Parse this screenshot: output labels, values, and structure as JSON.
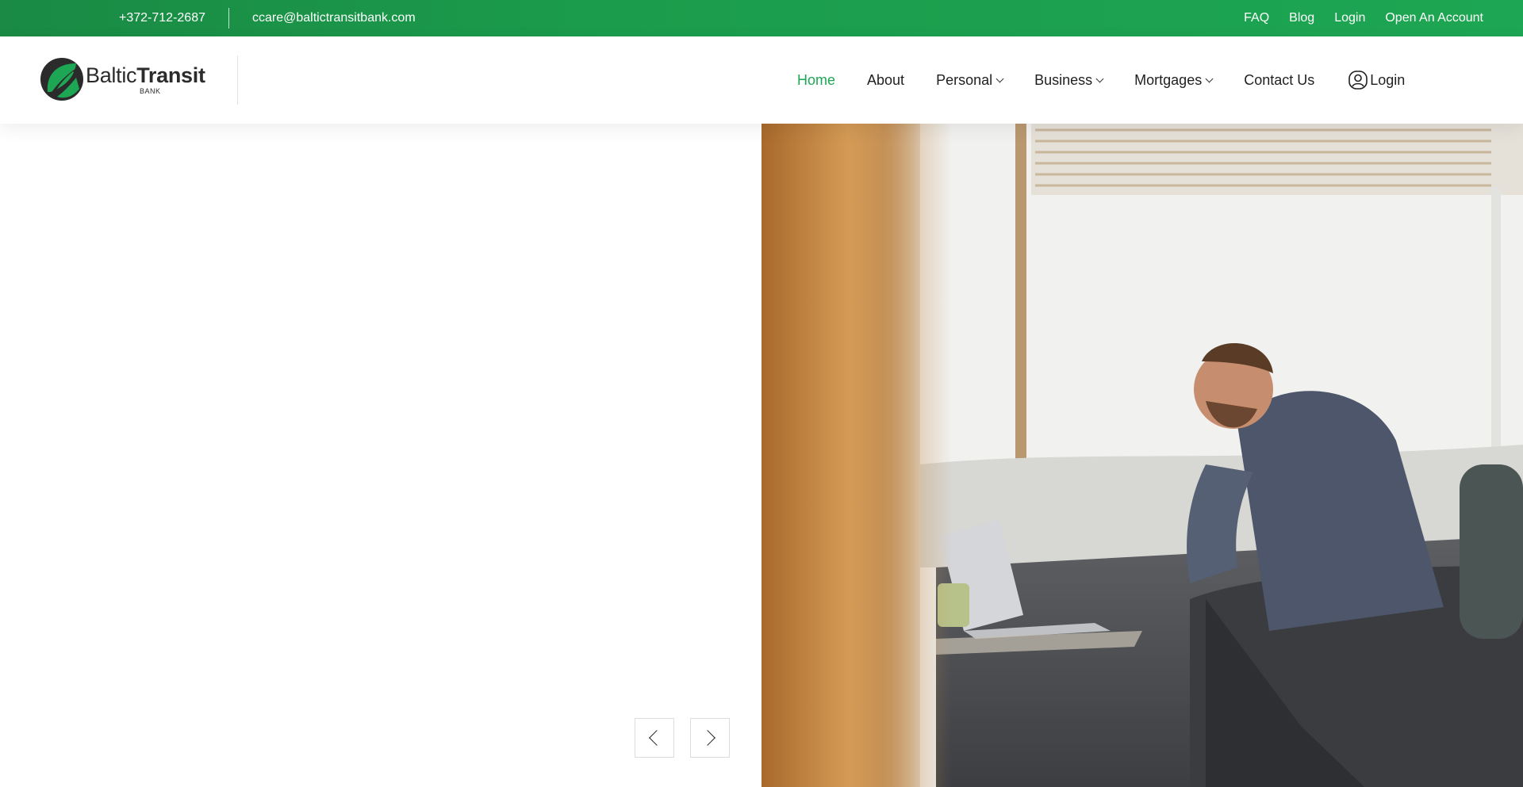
{
  "topbar": {
    "phone": "+372-712-2687",
    "email": "ccare@baltictransitbank.com",
    "links": [
      "FAQ",
      "Blog",
      "Login",
      "Open An Account"
    ]
  },
  "brand": {
    "name_light": "Baltic",
    "name_bold": "Transit",
    "sub": "BANK",
    "accent_color": "#1da653",
    "dark_color": "#2b2b2b"
  },
  "nav": {
    "items": [
      {
        "label": "Home",
        "active": true,
        "dropdown": false
      },
      {
        "label": "About",
        "active": false,
        "dropdown": false
      },
      {
        "label": "Personal",
        "active": false,
        "dropdown": true
      },
      {
        "label": "Business",
        "active": false,
        "dropdown": true
      },
      {
        "label": "Mortgages",
        "active": false,
        "dropdown": true
      },
      {
        "label": "Contact Us",
        "active": false,
        "dropdown": false
      }
    ],
    "login_label": "Login",
    "login_icon": "user-circle-icon"
  },
  "hero": {
    "image": "man-with-laptop-on-sofa-photo",
    "prev_icon": "chevron-left-icon",
    "next_icon": "chevron-right-icon"
  }
}
